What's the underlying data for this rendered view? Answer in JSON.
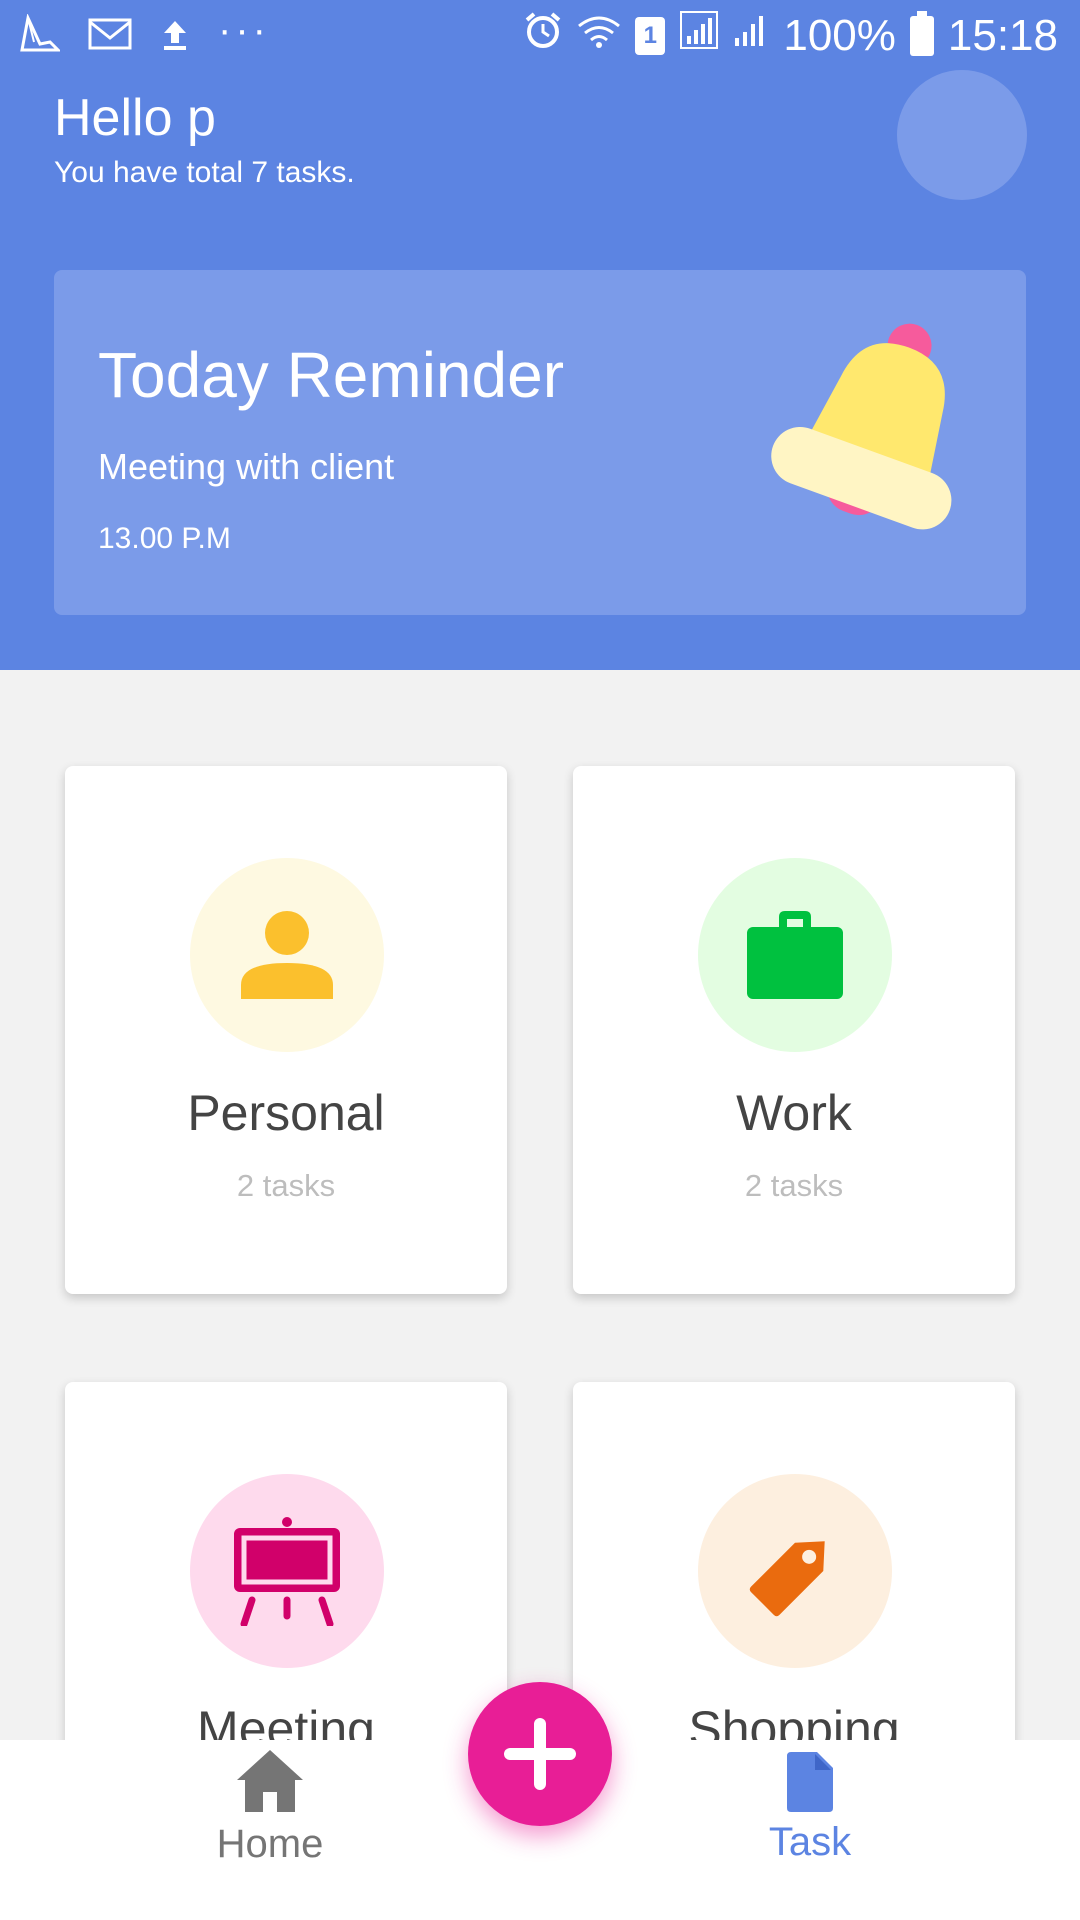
{
  "status_bar": {
    "battery_percent": "100%",
    "time": "15:18",
    "sim_slot": "1"
  },
  "header": {
    "greeting": "Hello p",
    "subtitle": "You have total 7 tasks."
  },
  "reminder": {
    "title": "Today Reminder",
    "description": "Meeting with client",
    "time": "13.00 P.M"
  },
  "categories": [
    {
      "name": "Personal",
      "count": "2 tasks",
      "icon": "person-icon",
      "icon_color": "#fbc02d",
      "bg_color": "#fef9e1"
    },
    {
      "name": "Work",
      "count": "2 tasks",
      "icon": "briefcase-icon",
      "icon_color": "#00c13f",
      "bg_color": "#e3fde1"
    },
    {
      "name": "Meeting",
      "count": "",
      "icon": "presentation-board-icon",
      "icon_color": "#d1006a",
      "bg_color": "#fedaed"
    },
    {
      "name": "Shopping",
      "count": "",
      "icon": "price-tag-icon",
      "icon_color": "#ea6b0e",
      "bg_color": "#fdefdf"
    }
  ],
  "bottom_nav": {
    "home_label": "Home",
    "task_label": "Task",
    "active": "Task"
  },
  "colors": {
    "header_bg": "#5c84e2",
    "reminder_bg": "#7b9be9",
    "fab": "#e81e96",
    "nav_active": "#5c84e2",
    "nav_inactive": "#757575"
  }
}
